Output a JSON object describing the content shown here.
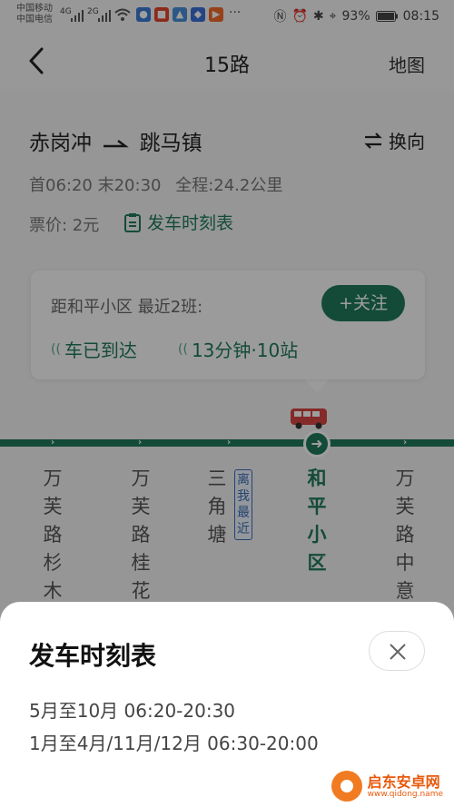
{
  "status_bar": {
    "carrier1": "中国移动",
    "carrier2": "中国电信",
    "net1": "4G",
    "net2": "2G",
    "battery": "93%",
    "time": "08:15",
    "more": "···"
  },
  "header": {
    "title": "15路",
    "map_label": "地图"
  },
  "route": {
    "from": "赤岗冲",
    "to": "跳马镇",
    "reverse_label": "换向",
    "first_last": "首06:20 末20:30",
    "total_length": "全程:24.2公里",
    "fare": "票价: 2元",
    "timetable_link": "发车时刻表"
  },
  "arrival_card": {
    "title": "距和平小区 最近2班:",
    "follow_label": "+关注",
    "bus1": "车已到达",
    "bus2": "13分钟·10站"
  },
  "stations": [
    {
      "name": "万芙路杉木"
    },
    {
      "name": "万芙路桂花"
    },
    {
      "name": "三角塘"
    },
    {
      "name": "和平小区"
    },
    {
      "name": "万芙路中意"
    }
  ],
  "near_tag": "离我最近",
  "colors": {
    "accent": "#1f7a5b",
    "near_tag": "#3d6fb8"
  },
  "sheet": {
    "title": "发车时刻表",
    "schedule": [
      "5月至10月 06:20-20:30",
      "1月至4月/11月/12月 06:30-20:00"
    ]
  },
  "watermark": {
    "name": "启东安卓网",
    "url": "www.qidong.name"
  }
}
